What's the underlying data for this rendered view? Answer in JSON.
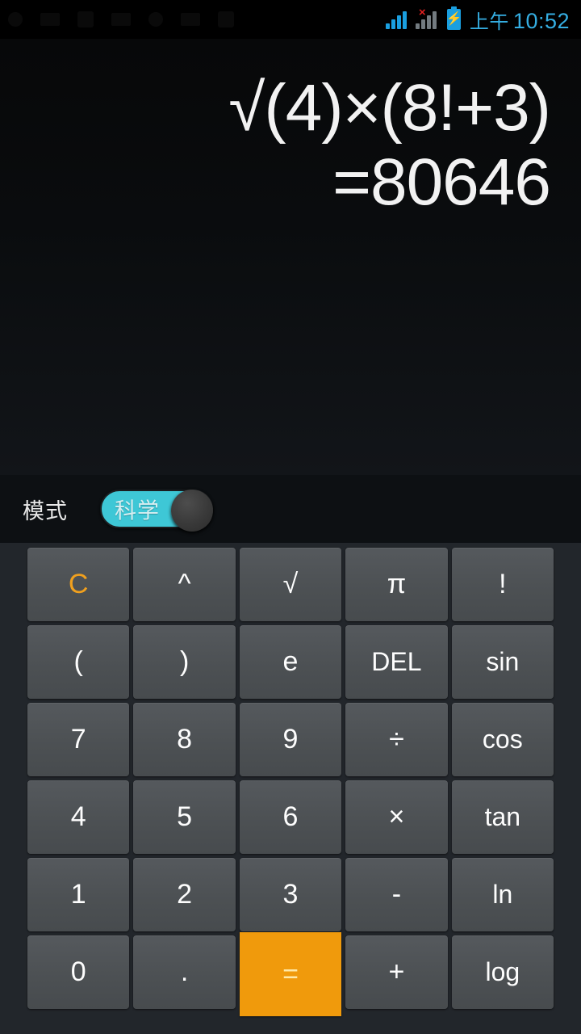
{
  "statusbar": {
    "signal_primary_icon": "signal-bars-icon",
    "signal_secondary_icon": "signal-bars-no-service-icon",
    "no_service_mark": "×",
    "battery_icon": "battery-charging-icon",
    "battery_bolt": "⚡",
    "ampm": "上午",
    "time": "10:52",
    "accent_color": "#35aee2",
    "alert_color": "#e02020"
  },
  "display": {
    "expression": "√(4)×(8!+3)",
    "result": "=80646",
    "text_color": "#f2f2f2"
  },
  "mode": {
    "label": "模式",
    "toggle_value": "科学",
    "toggle_on": true,
    "track_color": "#3ec7d6"
  },
  "keypad": {
    "accent_clear_color": "#f0a01e",
    "equals_color": "#f09a0c",
    "rows": [
      [
        {
          "label": "C",
          "name": "key-clear",
          "style": "clear"
        },
        {
          "label": "^",
          "name": "key-power",
          "style": ""
        },
        {
          "label": "√",
          "name": "key-sqrt",
          "style": ""
        },
        {
          "label": "π",
          "name": "key-pi",
          "style": ""
        },
        {
          "label": "!",
          "name": "key-factorial",
          "style": ""
        }
      ],
      [
        {
          "label": "(",
          "name": "key-open-paren",
          "style": ""
        },
        {
          "label": ")",
          "name": "key-close-paren",
          "style": ""
        },
        {
          "label": "e",
          "name": "key-euler",
          "style": ""
        },
        {
          "label": "DEL",
          "name": "key-delete",
          "style": "small"
        },
        {
          "label": "sin",
          "name": "key-sin",
          "style": "small"
        }
      ],
      [
        {
          "label": "7",
          "name": "key-7",
          "style": ""
        },
        {
          "label": "8",
          "name": "key-8",
          "style": ""
        },
        {
          "label": "9",
          "name": "key-9",
          "style": ""
        },
        {
          "label": "÷",
          "name": "key-divide",
          "style": ""
        },
        {
          "label": "cos",
          "name": "key-cos",
          "style": "small"
        }
      ],
      [
        {
          "label": "4",
          "name": "key-4",
          "style": ""
        },
        {
          "label": "5",
          "name": "key-5",
          "style": ""
        },
        {
          "label": "6",
          "name": "key-6",
          "style": ""
        },
        {
          "label": "×",
          "name": "key-multiply",
          "style": ""
        },
        {
          "label": "tan",
          "name": "key-tan",
          "style": "small"
        }
      ],
      [
        {
          "label": "1",
          "name": "key-1",
          "style": ""
        },
        {
          "label": "2",
          "name": "key-2",
          "style": ""
        },
        {
          "label": "3",
          "name": "key-3",
          "style": ""
        },
        {
          "label": "-",
          "name": "key-minus",
          "style": ""
        },
        {
          "label": "ln",
          "name": "key-ln",
          "style": "small"
        }
      ],
      [
        {
          "label": "0",
          "name": "key-0",
          "style": ""
        },
        {
          "label": ".",
          "name": "key-decimal",
          "style": ""
        },
        {
          "label": "=",
          "name": "key-equals",
          "style": "equals"
        },
        {
          "label": "+",
          "name": "key-plus",
          "style": ""
        },
        {
          "label": "log",
          "name": "key-log",
          "style": "small"
        }
      ]
    ]
  }
}
